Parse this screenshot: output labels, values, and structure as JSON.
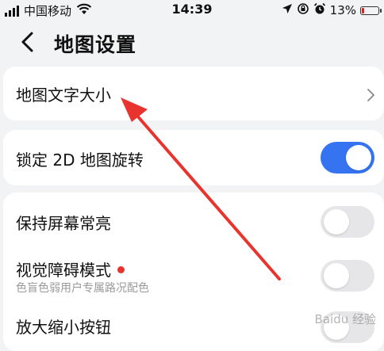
{
  "status_bar": {
    "carrier": "中国移动",
    "time": "14:39",
    "battery_percent": "13%",
    "icons": [
      "signal-icon",
      "wifi-icon",
      "location-icon",
      "lock-rotation-icon",
      "alarm-icon",
      "battery-icon"
    ]
  },
  "header": {
    "back_icon": "chevron-left-icon",
    "title": "地图设置"
  },
  "settings": {
    "map_text_size": {
      "label": "地图文字大小",
      "icon": "chevron-right-icon"
    },
    "lock_2d_rotation": {
      "label": "锁定 2D 地图旋转",
      "enabled": true
    },
    "keep_screen_on": {
      "label": "保持屏幕常亮",
      "enabled": false
    },
    "visual_impairment_mode": {
      "label": "视觉障碍模式",
      "sublabel": "色盲色弱用户专属路况配色",
      "enabled": false,
      "badge_color": "#e8332e"
    },
    "zoom_buttons": {
      "label": "放大缩小按钮",
      "enabled": false
    }
  },
  "colors": {
    "accent": "#3573f0",
    "annotation_arrow": "#e8332e",
    "background": "#f2f3f5"
  },
  "watermark": "Baidu 经验"
}
